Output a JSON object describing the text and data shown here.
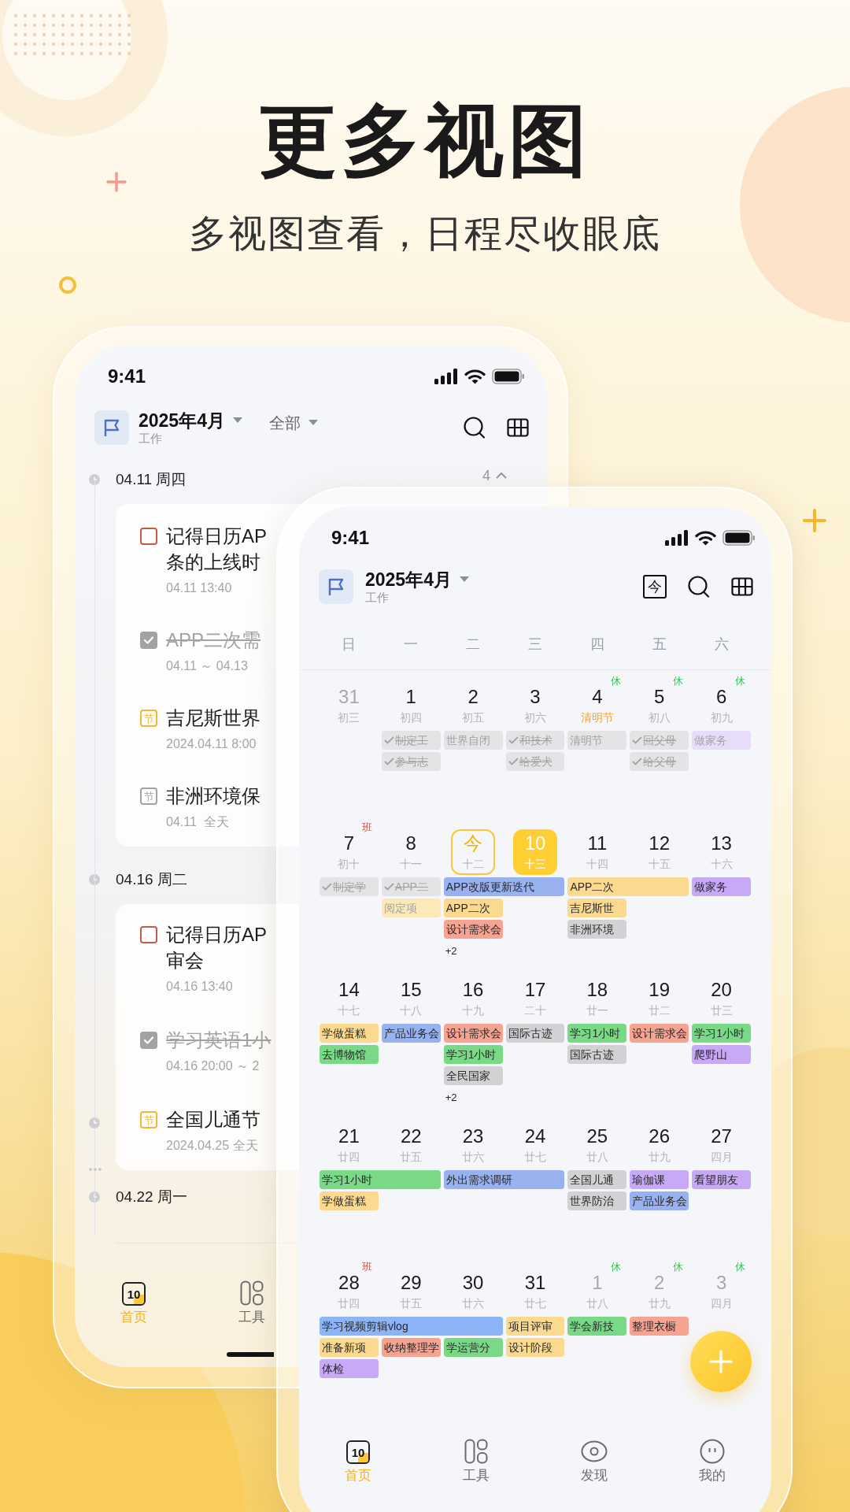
{
  "headline": {
    "title": "更多视图",
    "subtitle": "多视图查看，日程尽收眼底"
  },
  "back_phone": {
    "status_time": "9:41",
    "header": {
      "title": "2025年4月",
      "subtitle": "工作",
      "filter": "全部"
    },
    "groups": [
      {
        "date": "04.11 周四",
        "count": "4",
        "items": [
          {
            "kind": "task",
            "checked": false,
            "title_lines": [
              "记得日历AP",
              "条的上线时"
            ],
            "time": "04.11 13:40"
          },
          {
            "kind": "task",
            "checked": true,
            "title_lines": [
              "APP二次需"
            ],
            "time": "04.11 ～ 04.13"
          },
          {
            "kind": "holiday",
            "icon_text": "节",
            "color": "#f5b72e",
            "title_lines": [
              "吉尼斯世界"
            ],
            "time": "2024.04.11 8:00"
          },
          {
            "kind": "holiday",
            "icon_text": "节",
            "color": "#a3a3a3",
            "title_lines": [
              "非洲环境保"
            ],
            "time": "04.11  全天"
          }
        ]
      },
      {
        "date": "04.16 周二",
        "items": [
          {
            "kind": "task",
            "checked": false,
            "title_lines": [
              "记得日历AP",
              "审会"
            ],
            "time": "04.16 13:40"
          },
          {
            "kind": "task",
            "checked": true,
            "title_lines": [
              "学习英语1小"
            ],
            "time": "04.16 20:00 ～ 2"
          },
          {
            "kind": "holiday",
            "icon_text": "节",
            "color": "#f5b72e",
            "title_lines": [
              "全国儿通节"
            ],
            "time": "2024.04.25 全天"
          }
        ]
      },
      {
        "date": "04.22 周一"
      }
    ],
    "nav": [
      {
        "label": "首页",
        "selected": true,
        "kind": "calendar",
        "icon_text": "10"
      },
      {
        "label": "工具",
        "selected": false,
        "kind": "tools"
      }
    ]
  },
  "front_phone": {
    "status_time": "9:41",
    "header": {
      "title": "2025年4月",
      "subtitle": "工作",
      "today_icon_text": "今"
    },
    "weekdays": [
      "日",
      "一",
      "二",
      "三",
      "四",
      "五",
      "六"
    ],
    "weeks": [
      {
        "days": [
          {
            "date": "31",
            "lunar": "初三",
            "kind": "faded",
            "selected": false
          },
          {
            "date": "1",
            "lunar": "初四",
            "kind": "plain",
            "selected": false,
            "events": [
              {
                "kind": "done",
                "text": "制定工",
                "color": "#e4e4e7"
              },
              {
                "kind": "done",
                "text": "参与志",
                "color": "#e4e4e7"
              }
            ]
          },
          {
            "date": "2",
            "lunar": "初五",
            "kind": "plain",
            "selected": false,
            "events": [
              {
                "kind": "past",
                "text": "世界自闭",
                "color": "#e4e4e7"
              }
            ]
          },
          {
            "date": "3",
            "lunar": "初六",
            "kind": "plain",
            "selected": false,
            "events": [
              {
                "kind": "done",
                "text": "和技术",
                "color": "#e4e4e7"
              },
              {
                "kind": "done",
                "text": "给爱犬",
                "color": "#e4e4e7"
              }
            ]
          },
          {
            "date": "4",
            "lunar": "清明节",
            "kind": "festival",
            "selected": false,
            "badge": {
              "text": "休",
              "kind": "rest"
            },
            "events": [
              {
                "kind": "past",
                "text": "清明节",
                "color": "#e4e4e7"
              }
            ]
          },
          {
            "date": "5",
            "lunar": "初八",
            "kind": "plain",
            "selected": false,
            "badge": {
              "text": "休",
              "kind": "rest"
            },
            "events": [
              {
                "kind": "done",
                "text": "回父母",
                "color": "#e4e4e7"
              },
              {
                "kind": "done",
                "text": "给父母",
                "color": "#e4e4e7"
              }
            ]
          },
          {
            "date": "6",
            "lunar": "初九",
            "kind": "plain",
            "selected": false,
            "badge": {
              "text": "休",
              "kind": "rest"
            },
            "events": [
              {
                "kind": "past",
                "text": "做家务",
                "color": "#e7ddfb"
              }
            ]
          }
        ]
      },
      {
        "days": [
          {
            "date": "7",
            "lunar": "初十",
            "kind": "plain",
            "selected": false,
            "badge": {
              "text": "班",
              "kind": "work"
            },
            "events": [
              {
                "kind": "done",
                "text": "制定学",
                "color": "#e4e4e7"
              }
            ]
          },
          {
            "date": "8",
            "lunar": "十一",
            "kind": "plain",
            "selected": false,
            "events": [
              {
                "kind": "done",
                "text": "APP二",
                "color": "#e4e4e7"
              },
              {
                "kind": "past",
                "text": "阅定项",
                "color": "#fbe9b8"
              }
            ]
          },
          {
            "date": "今",
            "lunar": "十二",
            "kind": "today",
            "selected": false,
            "more": "+2",
            "events": [
              {
                "kind": "event",
                "text": "APP改版更新迭代",
                "color": "#98b1ef"
              },
              {
                "kind": "event",
                "text": "APP二次",
                "color": "#fbd98f"
              },
              {
                "kind": "event",
                "text": "设计需求会",
                "color": "#f7a392"
              }
            ]
          },
          {
            "date": "10",
            "lunar": "十三",
            "kind": "plain",
            "selected": true,
            "events": [
              {
                "kind": "continued"
              }
            ]
          },
          {
            "date": "11",
            "lunar": "十四",
            "kind": "plain",
            "selected": false,
            "events": [
              {
                "kind": "event",
                "text": "APP二次",
                "color": "#fbd98f"
              },
              {
                "kind": "event",
                "text": "吉尼斯世",
                "color": "#fbd98f"
              },
              {
                "kind": "event",
                "text": "非洲环境",
                "color": "#d2d2d4"
              }
            ]
          },
          {
            "date": "12",
            "lunar": "十五",
            "kind": "plain",
            "selected": false,
            "events": [
              {
                "kind": "continued"
              }
            ]
          },
          {
            "date": "13",
            "lunar": "十六",
            "kind": "plain",
            "selected": false,
            "events": [
              {
                "kind": "event",
                "text": "做家务",
                "color": "#c8a9f7"
              }
            ]
          }
        ]
      },
      {
        "days": [
          {
            "date": "14",
            "lunar": "十七",
            "kind": "plain",
            "selected": false,
            "events": [
              {
                "kind": "event",
                "text": "学做蛋糕",
                "color": "#fbd98f"
              },
              {
                "kind": "event",
                "text": "去博物馆",
                "color": "#79d987"
              }
            ]
          },
          {
            "date": "15",
            "lunar": "十八",
            "kind": "plain",
            "selected": false,
            "events": [
              {
                "kind": "event",
                "text": "产品业务会",
                "color": "#98b1ef"
              }
            ]
          },
          {
            "date": "16",
            "lunar": "十九",
            "kind": "plain",
            "selected": false,
            "more": "+2",
            "events": [
              {
                "kind": "event",
                "text": "设计需求会",
                "color": "#f7a392"
              },
              {
                "kind": "event",
                "text": "学习1小时",
                "color": "#79d987"
              },
              {
                "kind": "event",
                "text": "全民国家",
                "color": "#d2d2d4"
              }
            ]
          },
          {
            "date": "17",
            "lunar": "二十",
            "kind": "plain",
            "selected": false,
            "events": [
              {
                "kind": "event",
                "text": "国际古迹",
                "color": "#d2d2d4"
              }
            ]
          },
          {
            "date": "18",
            "lunar": "廿一",
            "kind": "plain",
            "selected": false,
            "events": [
              {
                "kind": "event",
                "text": "学习1小时",
                "color": "#79d987"
              },
              {
                "kind": "event",
                "text": "国际古迹",
                "color": "#d2d2d4"
              }
            ]
          },
          {
            "date": "19",
            "lunar": "廿二",
            "kind": "plain",
            "selected": false,
            "events": [
              {
                "kind": "event",
                "text": "设计需求会",
                "color": "#f7a392"
              }
            ]
          },
          {
            "date": "20",
            "lunar": "廿三",
            "kind": "plain",
            "selected": false,
            "events": [
              {
                "kind": "event",
                "text": "学习1小时",
                "color": "#79d987"
              },
              {
                "kind": "event",
                "text": "爬野山",
                "color": "#c8a9f7"
              }
            ]
          }
        ]
      },
      {
        "days": [
          {
            "date": "21",
            "lunar": "廿四",
            "kind": "plain",
            "selected": false,
            "events": [
              {
                "kind": "event",
                "text": "学习1小时",
                "color": "#79d987"
              },
              {
                "kind": "event",
                "text": "学做蛋糕",
                "color": "#fbd98f"
              }
            ]
          },
          {
            "date": "22",
            "lunar": "廿五",
            "kind": "plain",
            "selected": false,
            "events": [
              {
                "kind": "continued"
              }
            ]
          },
          {
            "date": "23",
            "lunar": "廿六",
            "kind": "plain",
            "selected": false,
            "events": [
              {
                "kind": "event",
                "text": "外出需求调研",
                "color": "#98b1ef"
              }
            ]
          },
          {
            "date": "24",
            "lunar": "廿七",
            "kind": "plain",
            "selected": false,
            "events": [
              {
                "kind": "continued"
              }
            ]
          },
          {
            "date": "25",
            "lunar": "廿八",
            "kind": "plain",
            "selected": false,
            "events": [
              {
                "kind": "event",
                "text": "全国儿通",
                "color": "#d2d2d4"
              },
              {
                "kind": "event",
                "text": "世界防治",
                "color": "#d2d2d4"
              }
            ]
          },
          {
            "date": "26",
            "lunar": "廿九",
            "kind": "plain",
            "selected": false,
            "events": [
              {
                "kind": "event",
                "text": "瑜伽课",
                "color": "#c8a9f7"
              },
              {
                "kind": "event",
                "text": "产品业务会",
                "color": "#98b1ef"
              }
            ]
          },
          {
            "date": "27",
            "lunar": "四月",
            "kind": "plain",
            "selected": false,
            "events": [
              {
                "kind": "event",
                "text": "看望朋友",
                "color": "#c8a9f7"
              }
            ]
          }
        ]
      },
      {
        "days": [
          {
            "date": "28",
            "lunar": "廿四",
            "kind": "plain",
            "selected": false,
            "badge": {
              "text": "班",
              "kind": "work"
            },
            "events": [
              {
                "kind": "event",
                "text": "学习视频剪辑vlog",
                "color": "#8cb4f6"
              },
              {
                "kind": "event",
                "text": "准备新项",
                "color": "#fbd98f"
              },
              {
                "kind": "event",
                "text": "体检",
                "color": "#c8a9f7"
              }
            ]
          },
          {
            "date": "29",
            "lunar": "廿五",
            "kind": "plain",
            "selected": false,
            "events": [
              {
                "kind": "continued"
              },
              {
                "kind": "event",
                "text": "收纳整理学",
                "color": "#f7a392"
              }
            ]
          },
          {
            "date": "30",
            "lunar": "廿六",
            "kind": "plain",
            "selected": false,
            "events": [
              {
                "kind": "continued"
              },
              {
                "kind": "event",
                "text": "学运营分",
                "color": "#79d987"
              }
            ]
          },
          {
            "date": "31",
            "lunar": "廿七",
            "kind": "plain",
            "selected": false,
            "events": [
              {
                "kind": "event",
                "text": "项目评审",
                "color": "#fbd98f"
              },
              {
                "kind": "event",
                "text": "设计阶段",
                "color": "#fbd98f"
              }
            ]
          },
          {
            "date": "1",
            "lunar": "廿八",
            "kind": "faded",
            "selected": false,
            "badge": {
              "text": "休",
              "kind": "rest"
            },
            "events": [
              {
                "kind": "event",
                "text": "学会新技",
                "color": "#79d987"
              }
            ]
          },
          {
            "date": "2",
            "lunar": "廿九",
            "kind": "faded",
            "selected": false,
            "badge": {
              "text": "休",
              "kind": "rest"
            },
            "events": [
              {
                "kind": "event",
                "text": "整理衣橱",
                "color": "#f7a392"
              }
            ]
          },
          {
            "date": "3",
            "lunar": "四月",
            "kind": "faded",
            "selected": false,
            "badge": {
              "text": "休",
              "kind": "rest"
            }
          }
        ]
      }
    ],
    "nav": [
      {
        "label": "首页",
        "selected": true,
        "kind": "calendar",
        "icon_text": "10"
      },
      {
        "label": "工具",
        "selected": false,
        "kind": "tools"
      },
      {
        "label": "发现",
        "selected": false,
        "kind": "discover"
      },
      {
        "label": "我的",
        "selected": false,
        "kind": "profile"
      }
    ]
  }
}
